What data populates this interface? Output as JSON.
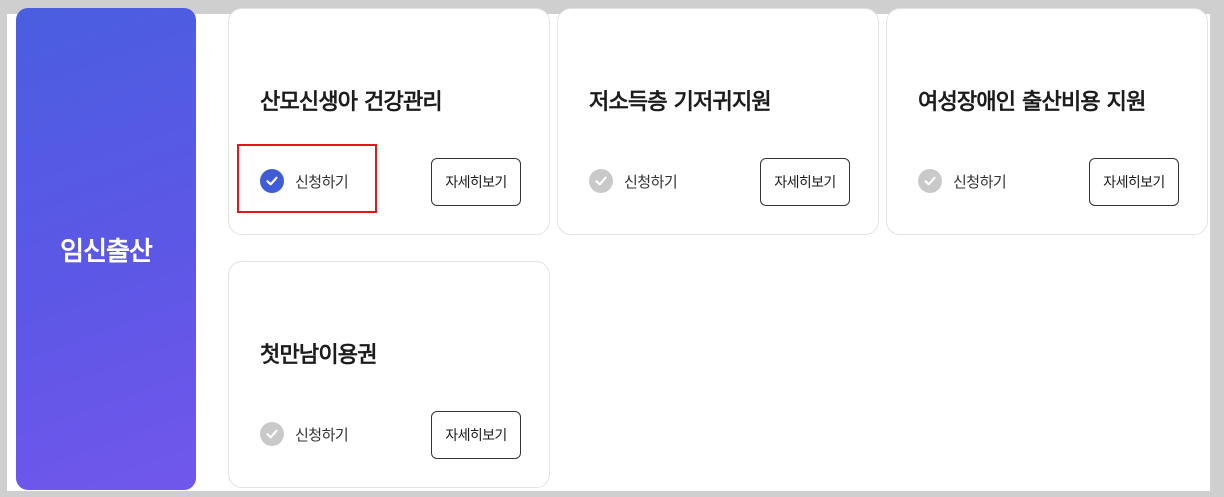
{
  "category": {
    "label": "임신출산"
  },
  "cards": [
    {
      "title": "산모신생아 건강관리",
      "apply_label": "신청하기",
      "apply_checked": true,
      "detail_label": "자세히보기"
    },
    {
      "title": "저소득층 기저귀지원",
      "apply_label": "신청하기",
      "apply_checked": false,
      "detail_label": "자세히보기"
    },
    {
      "title": "여성장애인 출산비용 지원",
      "apply_label": "신청하기",
      "apply_checked": false,
      "detail_label": "자세히보기"
    },
    {
      "title": "첫만남이용권",
      "apply_label": "신청하기",
      "apply_checked": false,
      "detail_label": "자세히보기"
    }
  ],
  "colors": {
    "accent": "#3f5bd6",
    "highlight_box": "#e0161b",
    "check_inactive": "#c9c9c9"
  }
}
